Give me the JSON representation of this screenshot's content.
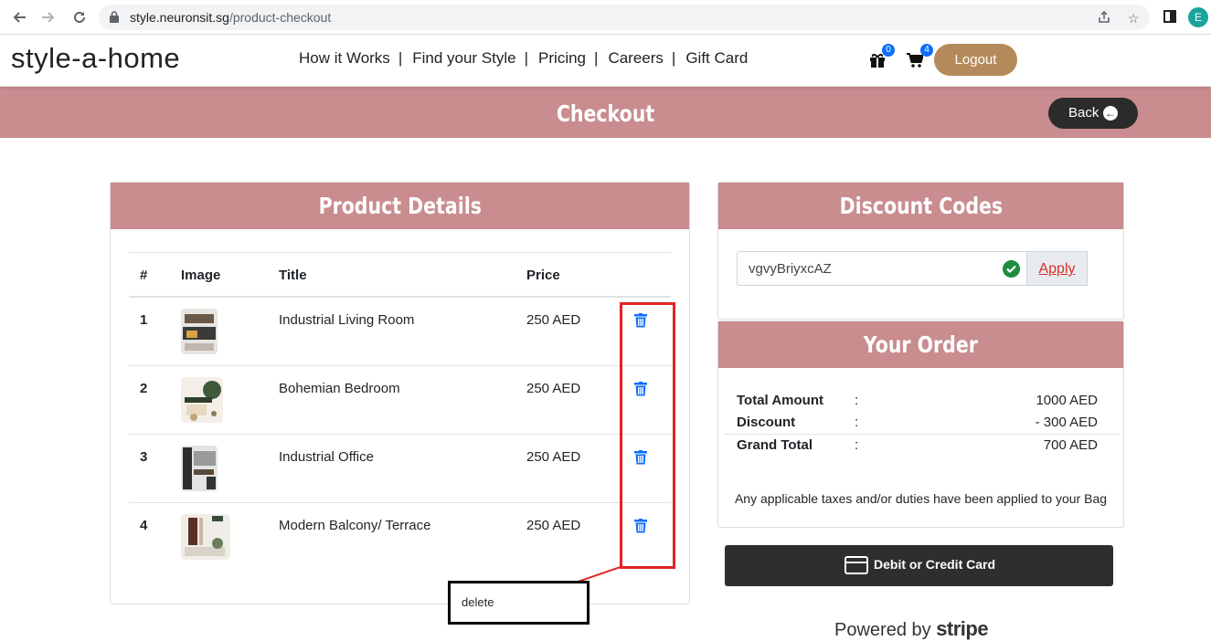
{
  "browser": {
    "url_host": "style.neuronsit.sg",
    "url_path": "/product-checkout",
    "profile_initial": "E"
  },
  "header": {
    "logo": "style-a-home",
    "menu": [
      "How it Works",
      "Find your Style",
      "Pricing",
      "Careers",
      "Gift Card"
    ],
    "separator": "|",
    "gift_count": "0",
    "cart_count": "4",
    "logout_label": "Logout"
  },
  "banner": {
    "title": "Checkout",
    "back_label": "Back"
  },
  "products": {
    "heading": "Product Details",
    "columns": [
      "#",
      "Image",
      "Title",
      "Price"
    ],
    "rows": [
      {
        "num": "1",
        "title": "Industrial Living Room",
        "price": "250 AED"
      },
      {
        "num": "2",
        "title": "Bohemian Bedroom",
        "price": "250 AED"
      },
      {
        "num": "3",
        "title": "Industrial Office",
        "price": "250 AED"
      },
      {
        "num": "4",
        "title": "Modern Balcony/ Terrace",
        "price": "250 AED"
      }
    ]
  },
  "discount": {
    "heading": "Discount Codes",
    "code_value": "vgvyBriyxcAZ",
    "apply_label": "Apply"
  },
  "order": {
    "heading": "Your Order",
    "rows": [
      {
        "label": "Total Amount",
        "colon": ":",
        "value": "1000 AED"
      },
      {
        "label": "Discount",
        "colon": ":",
        "value": "- 300 AED"
      },
      {
        "label": "Grand Total",
        "colon": ":",
        "value": "700 AED"
      }
    ],
    "tax_note": "Any applicable taxes and/or duties have been applied to your Bag"
  },
  "payment": {
    "button_label": "Debit or Credit Card",
    "powered_prefix": "Powered by",
    "powered_brand": "stripe"
  },
  "annotation": {
    "label": "delete",
    "box_color": "#e02424"
  },
  "colors": {
    "brand_pink": "#c98c8f",
    "logout_brown": "#b58a5a",
    "trash_blue": "#0d6efd",
    "dark_button": "#2e2e2e"
  }
}
